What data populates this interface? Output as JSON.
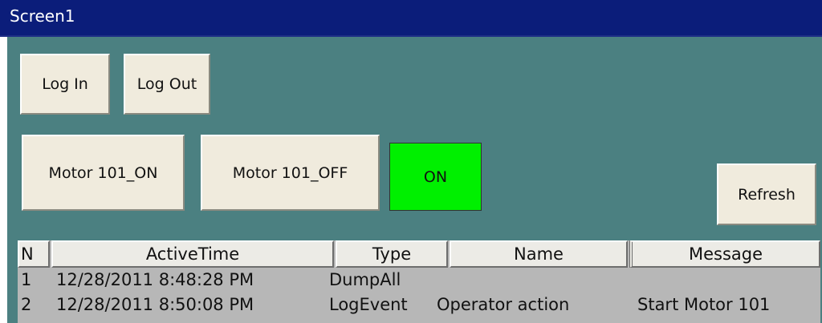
{
  "window": {
    "title": "Screen1"
  },
  "buttons": {
    "log_in": "Log In",
    "log_out": "Log Out",
    "motor_on": "Motor 101_ON",
    "motor_off": "Motor 101_OFF",
    "refresh": "Refresh"
  },
  "indicator": {
    "label": "ON",
    "color": "#00f000"
  },
  "colors": {
    "titlebar": "#0b1d7a",
    "panel": "#4b8081",
    "button": "#f0ebdd",
    "grid": "#b7b7b7"
  },
  "grid": {
    "columns": [
      "N",
      "ActiveTime",
      "Type",
      "Name",
      "Message"
    ],
    "rows": [
      {
        "n": "1",
        "active_time": "12/28/2011 8:48:28 PM",
        "type": "DumpAll",
        "name": "",
        "message": ""
      },
      {
        "n": "2",
        "active_time": "12/28/2011 8:50:08 PM",
        "type": "LogEvent",
        "name": "Operator action",
        "message": "Start Motor 101"
      }
    ]
  }
}
